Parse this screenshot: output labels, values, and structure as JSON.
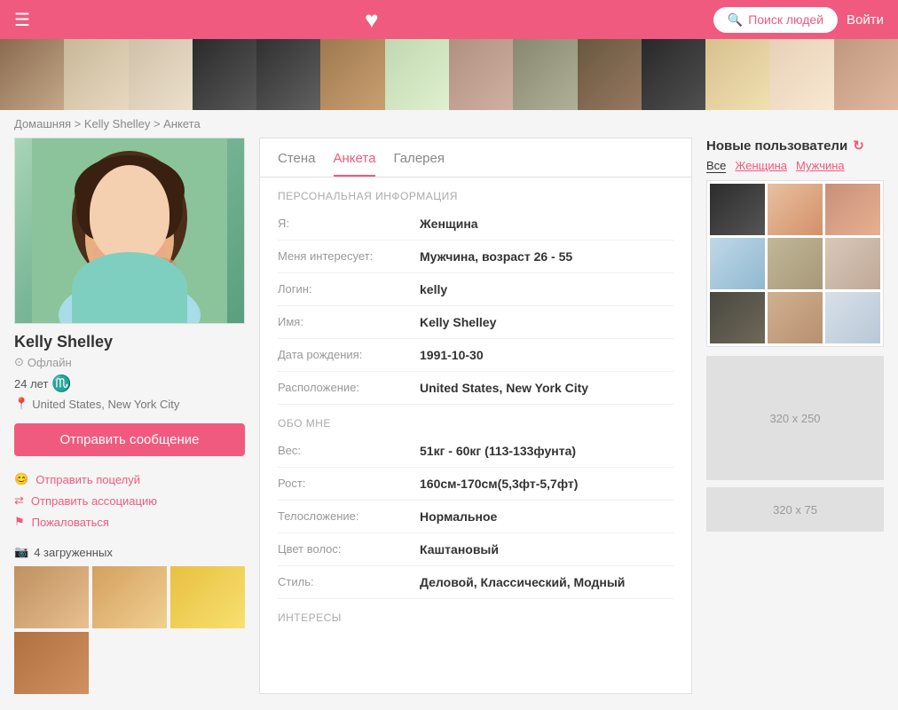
{
  "header": {
    "search_label": "Поиск людей",
    "login_label": "Войти"
  },
  "breadcrumb": {
    "home": "Домашняя",
    "name": "Kelly Shelley",
    "current": "Анкета"
  },
  "profile": {
    "name": "Kelly Shelley",
    "status": "Офлайн",
    "age": "24 лет",
    "zodiac": "♏",
    "location": "United States, New York City",
    "send_message": "Отправить сообщение",
    "action1": "Отправить поцелуй",
    "action2": "Отправить ассоциацию",
    "action3": "Пожаловаться",
    "photos_label": "4 загруженных"
  },
  "tabs": {
    "wall": "Стена",
    "profile": "Анкета",
    "gallery": "Галерея"
  },
  "personal_info": {
    "section_title": "ПЕРСОНАЛЬНАЯ ИНФОРМАЦИЯ",
    "fields": [
      {
        "label": "Я:",
        "value": "Женщина"
      },
      {
        "label": "Меня интересует:",
        "value": "Мужчина, возраст 26 - 55"
      },
      {
        "label": "Логин:",
        "value": "kelly"
      },
      {
        "label": "Имя:",
        "value": "Kelly Shelley"
      },
      {
        "label": "Дата рождения:",
        "value": "1991-10-30"
      },
      {
        "label": "Расположение:",
        "value": "United States, New York City"
      }
    ]
  },
  "about_me": {
    "section_title": "ОБО МНЕ",
    "fields": [
      {
        "label": "Вес:",
        "value": "51кг - 60кг (113-133фунта)"
      },
      {
        "label": "Рост:",
        "value": "160см-170см(5,3фт-5,7фт)"
      },
      {
        "label": "Телосложение:",
        "value": "Нормальное"
      },
      {
        "label": "Цвет волос:",
        "value": "Каштановый"
      },
      {
        "label": "Стиль:",
        "value": "Деловой, Классический, Модный"
      }
    ]
  },
  "interests": {
    "section_title": "ИНТЕРЕСЫ"
  },
  "new_users": {
    "title": "Новые пользователи",
    "filters": [
      "Все",
      "Женщина",
      "Мужчина"
    ]
  },
  "ads": {
    "main": "320 x 250",
    "small": "320 x 75"
  }
}
